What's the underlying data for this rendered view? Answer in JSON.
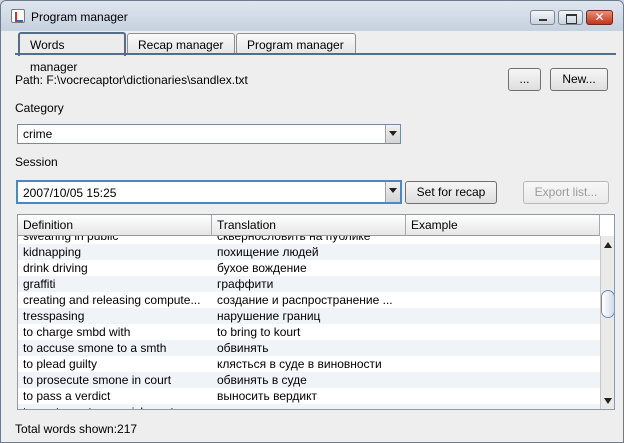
{
  "window": {
    "title": "Program manager"
  },
  "tabs": [
    {
      "label": "Words manager",
      "active": true
    },
    {
      "label": "Recap manager",
      "active": false
    },
    {
      "label": "Program manager",
      "active": false
    }
  ],
  "path": {
    "text": "Path: F:\\vocrecaptor\\dictionaries\\sandlex.txt"
  },
  "buttons": {
    "browse": "...",
    "new": "New...",
    "set_for_recap": "Set for recap",
    "export_list": "Export list..."
  },
  "category": {
    "label": "Category",
    "selected": "crime"
  },
  "session": {
    "label": "Session",
    "selected": "2007/10/05 15:25"
  },
  "table": {
    "headers": [
      "Definition",
      "Translation",
      "Example"
    ],
    "rows": [
      {
        "definition": "swearing in public",
        "translation": "сквернословить на публике",
        "example": ""
      },
      {
        "definition": "kidnapping",
        "translation": "похищение людей",
        "example": ""
      },
      {
        "definition": "drink driving",
        "translation": "бухое вождение",
        "example": ""
      },
      {
        "definition": "graffiti",
        "translation": "граффити",
        "example": ""
      },
      {
        "definition": "creating and releasing compute...",
        "translation": "создание и распространение ...",
        "example": ""
      },
      {
        "definition": "tresspasing",
        "translation": "нарушение границ",
        "example": ""
      },
      {
        "definition": "to charge smbd with",
        "translation": "to bring to kourt",
        "example": ""
      },
      {
        "definition": "to accuse smone to a smth",
        "translation": "обвинять",
        "example": ""
      },
      {
        "definition": "to plead guilty",
        "translation": "клясться в суде в виновности",
        "example": ""
      },
      {
        "definition": "to prosecute smone in court",
        "translation": "обвинять в суде",
        "example": ""
      },
      {
        "definition": "to pass a verdict",
        "translation": "выносить вердикт",
        "example": ""
      },
      {
        "definition": "to sentence to a punishment",
        "translation": "назначить наказание",
        "example": ""
      }
    ],
    "scroll_position": 0.33
  },
  "status": {
    "text": "Total words shown:217"
  }
}
